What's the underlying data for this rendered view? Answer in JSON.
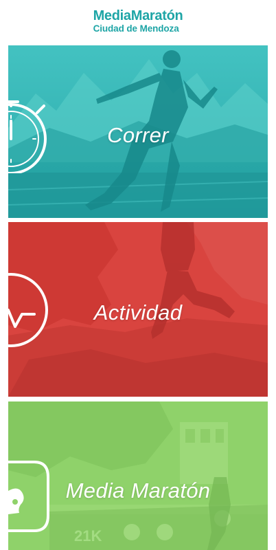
{
  "header": {
    "logo_line1": "MediaMaratón",
    "logo_line2": "Ciudad de Mendoza"
  },
  "cards": [
    {
      "label": "Correr",
      "icon": "stopwatch-icon",
      "color": "#2bb4b4"
    },
    {
      "label": "Actividad",
      "icon": "heartbeat-icon",
      "color": "#d8423d"
    },
    {
      "label": "Media Maratón",
      "icon": "runner-shoe-icon",
      "color": "#8fd26a"
    }
  ],
  "photo_texts": {
    "bib": "21K"
  },
  "colors": {
    "brand": "#1ea5a6",
    "teal": "#2bb4b4",
    "red": "#d8423d",
    "green": "#8fd26a"
  }
}
